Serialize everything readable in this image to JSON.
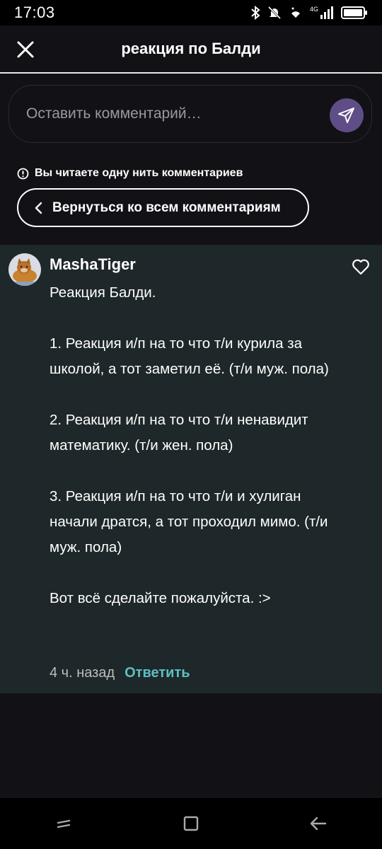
{
  "status_bar": {
    "time": "17:03",
    "network": "4G"
  },
  "header": {
    "title": "реакция по Балди",
    "close_icon": "close-icon"
  },
  "comment_input": {
    "placeholder": "Оставить комментарий…",
    "send_icon": "send-icon"
  },
  "thread": {
    "notice": "Вы читаете одну нить комментариев",
    "back_label": "Вернуться ко всем комментариям"
  },
  "comment": {
    "author": "MashaTiger",
    "text": "Реакция Балди.\n\n1. Реакция и/п на то что т/и курила за школой, а тот заметил её. (т/и муж. пола)\n\n2. Реакция и/п на то что т/и ненавидит математику. (т/и жен. пола)\n\n3. Реакция и/п на то что т/и и хулиган начали дратся, а тот проходил мимо. (т/и муж. пола)\n\nВот всё сделайте пожалуйста. :>",
    "time": "4 ч. назад",
    "reply_label": "Ответить"
  },
  "colors": {
    "accent": "#5e4d86",
    "reply": "#5fbec0",
    "card": "#1e2729",
    "background": "#121115"
  }
}
